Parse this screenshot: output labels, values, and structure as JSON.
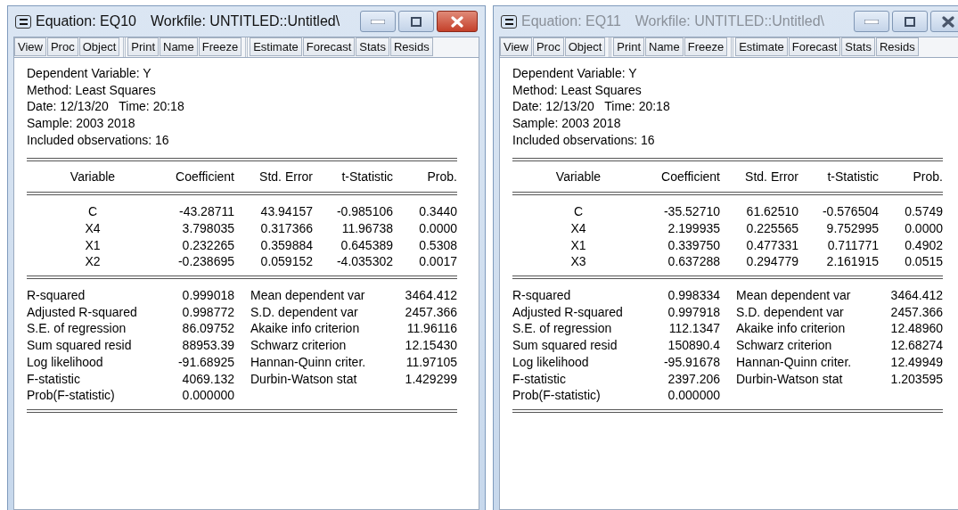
{
  "windows": [
    {
      "active": true,
      "title": {
        "object": "Equation: EQ10",
        "workfile": "Workfile: UNTITLED::Untitled\\"
      },
      "toolbar": [
        [
          "View",
          "Proc",
          "Object"
        ],
        [
          "Print",
          "Name",
          "Freeze"
        ],
        [
          "Estimate",
          "Forecast",
          "Stats",
          "Resids"
        ]
      ],
      "header": [
        "Dependent Variable: Y",
        "Method: Least Squares",
        "Date: 12/13/20   Time: 20:18",
        "Sample: 2003 2018",
        "Included observations: 16"
      ],
      "table": {
        "columns": [
          "Variable",
          "Coefficient",
          "Std. Error",
          "t-Statistic",
          "Prob."
        ],
        "rows": [
          [
            "C",
            "-43.28711",
            "43.94157",
            "-0.985106",
            "0.3440"
          ],
          [
            "X4",
            "3.798035",
            "0.317366",
            "11.96738",
            "0.0000"
          ],
          [
            "X1",
            "0.232265",
            "0.359884",
            "0.645389",
            "0.5308"
          ],
          [
            "X2",
            "-0.238695",
            "0.059152",
            "-4.035302",
            "0.0017"
          ]
        ]
      },
      "statistics": [
        [
          "R-squared",
          "0.999018",
          "Mean dependent var",
          "3464.412"
        ],
        [
          "Adjusted R-squared",
          "0.998772",
          "S.D. dependent var",
          "2457.366"
        ],
        [
          "S.E. of regression",
          "86.09752",
          "Akaike info criterion",
          "11.96116"
        ],
        [
          "Sum squared resid",
          "88953.39",
          "Schwarz criterion",
          "12.15430"
        ],
        [
          "Log likelihood",
          "-91.68925",
          "Hannan-Quinn criter.",
          "11.97105"
        ],
        [
          "F-statistic",
          "4069.132",
          "Durbin-Watson stat",
          "1.429299"
        ],
        [
          "Prob(F-statistic)",
          "0.000000"
        ]
      ]
    },
    {
      "active": false,
      "title": {
        "object": "Equation: EQ11",
        "workfile": "Workfile: UNTITLED::Untitled\\"
      },
      "toolbar": [
        [
          "View",
          "Proc",
          "Object"
        ],
        [
          "Print",
          "Name",
          "Freeze"
        ],
        [
          "Estimate",
          "Forecast",
          "Stats",
          "Resids"
        ]
      ],
      "header": [
        "Dependent Variable: Y",
        "Method: Least Squares",
        "Date: 12/13/20   Time: 20:18",
        "Sample: 2003 2018",
        "Included observations: 16"
      ],
      "table": {
        "columns": [
          "Variable",
          "Coefficient",
          "Std. Error",
          "t-Statistic",
          "Prob."
        ],
        "rows": [
          [
            "C",
            "-35.52710",
            "61.62510",
            "-0.576504",
            "0.5749"
          ],
          [
            "X4",
            "2.199935",
            "0.225565",
            "9.752995",
            "0.0000"
          ],
          [
            "X1",
            "0.339750",
            "0.477331",
            "0.711771",
            "0.4902"
          ],
          [
            "X3",
            "0.637288",
            "0.294779",
            "2.161915",
            "0.0515"
          ]
        ]
      },
      "statistics": [
        [
          "R-squared",
          "0.998334",
          "Mean dependent var",
          "3464.412"
        ],
        [
          "Adjusted R-squared",
          "0.997918",
          "S.D. dependent var",
          "2457.366"
        ],
        [
          "S.E. of regression",
          "112.1347",
          "Akaike info criterion",
          "12.48960"
        ],
        [
          "Sum squared resid",
          "150890.4",
          "Schwarz criterion",
          "12.68274"
        ],
        [
          "Log likelihood",
          "-95.91678",
          "Hannan-Quinn criter.",
          "12.49949"
        ],
        [
          "F-statistic",
          "2397.206",
          "Durbin-Watson stat",
          "1.203595"
        ],
        [
          "Prob(F-statistic)",
          "0.000000"
        ]
      ]
    }
  ]
}
